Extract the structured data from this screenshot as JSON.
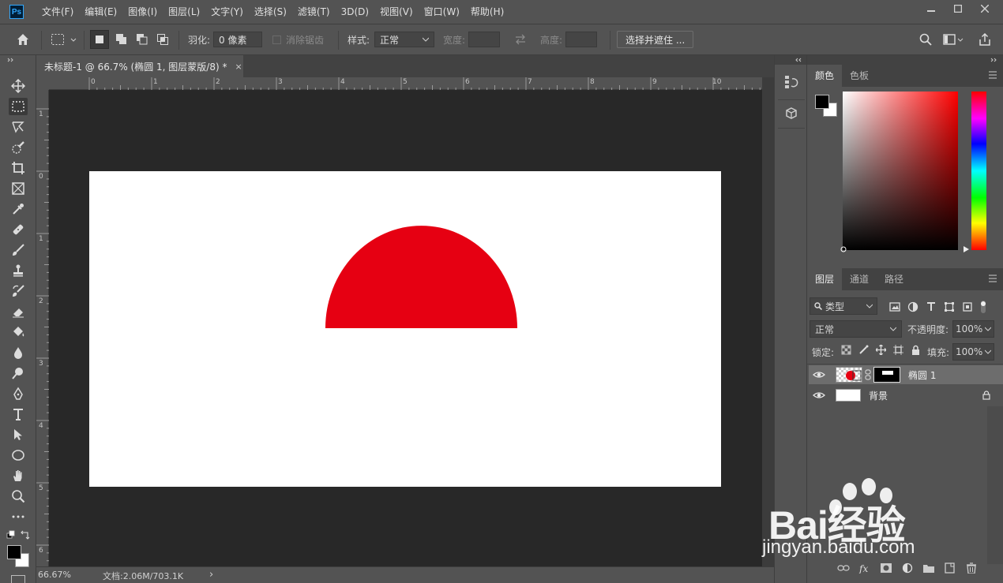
{
  "app": {
    "logo": "Ps"
  },
  "menu": [
    "文件(F)",
    "编辑(E)",
    "图像(I)",
    "图层(L)",
    "文字(Y)",
    "选择(S)",
    "滤镜(T)",
    "3D(D)",
    "视图(V)",
    "窗口(W)",
    "帮助(H)"
  ],
  "options": {
    "feather_label": "羽化:",
    "feather_value": "0 像素",
    "antialias_label": "消除锯齿",
    "style_label": "样式:",
    "style_value": "正常",
    "width_label": "宽度:",
    "height_label": "高度:",
    "select_mask_label": "选择并遮住 ..."
  },
  "document": {
    "tab_title": "未标题-1 @ 66.7% (椭圆 1, 图层蒙版/8) *",
    "close": "×",
    "ruler_top": [
      "0",
      "1",
      "2",
      "3",
      "4",
      "5",
      "6",
      "7",
      "8",
      "9",
      "10"
    ],
    "ruler_left": [
      "1",
      "0",
      "1",
      "2",
      "3",
      "4",
      "5",
      "6"
    ],
    "shape_color": "#e60012"
  },
  "status": {
    "zoom": "66.67%",
    "doc_info": "文档:2.06M/703.1K",
    "arrow": "›"
  },
  "color_panel": {
    "tabs": [
      "颜色",
      "色板"
    ],
    "foreground": "#000000",
    "background": "#ffffff",
    "base_hue": "#ff0000"
  },
  "layers_panel": {
    "tabs": [
      "图层",
      "通道",
      "路径"
    ],
    "filter_value": "类型",
    "blend_mode": "正常",
    "opacity_label": "不透明度:",
    "opacity_value": "100%",
    "lock_label": "锁定:",
    "fill_label": "填充:",
    "fill_value": "100%",
    "layers": [
      {
        "name": "椭圆 1",
        "visible": true,
        "selected": true
      },
      {
        "name": "背景",
        "visible": true,
        "locked": true
      }
    ]
  },
  "watermark": {
    "brand": "Bai经验",
    "url": "jingyan.baidu.com"
  }
}
